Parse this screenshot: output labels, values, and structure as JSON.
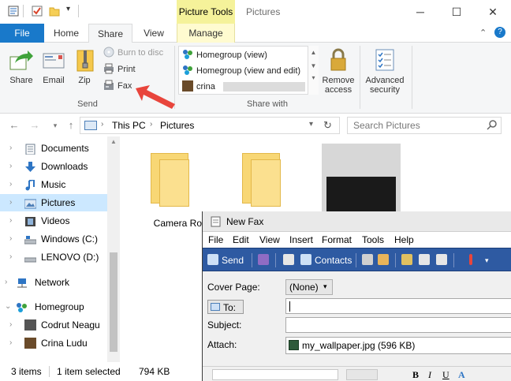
{
  "window": {
    "title": "Pictures",
    "contextual_tab": "Picture Tools",
    "minimize": "─",
    "maximize": "☐",
    "close": "✕"
  },
  "ribbon_tabs": {
    "file": "File",
    "home": "Home",
    "share": "Share",
    "view": "View",
    "manage": "Manage"
  },
  "ribbon": {
    "share_button": "Share",
    "email_button": "Email",
    "zip_button": "Zip",
    "burn": "Burn to disc",
    "print": "Print",
    "fax": "Fax",
    "send_group": "Send",
    "share_with_group": "Share with",
    "share_list": [
      "Homegroup (view)",
      "Homegroup (view and edit)",
      "crina"
    ],
    "remove_access": [
      "Remove",
      "access"
    ],
    "advanced_security": [
      "Advanced",
      "security"
    ]
  },
  "address": {
    "crumbs": [
      "This PC",
      "Pictures"
    ],
    "search_placeholder": "Search Pictures"
  },
  "nav": {
    "items": [
      "Documents",
      "Downloads",
      "Music",
      "Pictures",
      "Videos",
      "Windows (C:)",
      "LENOVO (D:)",
      "Network",
      "Homegroup",
      "Codrut Neagu",
      "Crina Ludu"
    ]
  },
  "content": {
    "items": [
      "Camera Roll"
    ]
  },
  "status": {
    "count": "3 items",
    "selected": "1 item selected",
    "size": "794 KB"
  },
  "fax": {
    "title": "New Fax",
    "menu": [
      "File",
      "Edit",
      "View",
      "Insert",
      "Format",
      "Tools",
      "Help"
    ],
    "toolbar": {
      "send": "Send",
      "contacts": "Contacts"
    },
    "cover_page_label": "Cover Page:",
    "cover_page_value": "(None)",
    "to_button": "To:",
    "subject_label": "Subject:",
    "attach_label": "Attach:",
    "attachment": "my_wallpaper.jpg (596 KB)"
  },
  "colors": {
    "accent": "#1979ca",
    "contextual": "#f5f29a",
    "fax_toolbar": "#2e5aa2",
    "selection": "#cce8ff",
    "arrow": "#e8453c"
  }
}
